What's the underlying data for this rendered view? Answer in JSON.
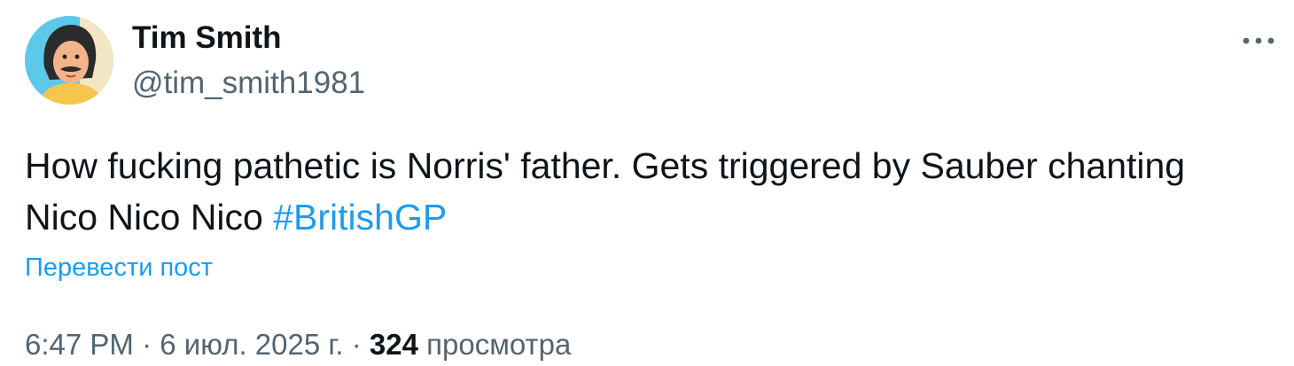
{
  "author": {
    "display_name": "Tim Smith",
    "handle": "@tim_smith1981",
    "avatar_icon": "cartoon-character-avatar"
  },
  "post": {
    "text_before": "How fucking pathetic is Norris' father. Gets triggered by Sauber chanting\nNico Nico Nico ",
    "hashtag": "#BritishGP",
    "translate_label": "Перевести пост"
  },
  "meta": {
    "time": "6:47 PM",
    "separator1": " · ",
    "date": "6 июл. 2025 г.",
    "separator2": " · ",
    "views_count": "324",
    "views_label": " просмотра"
  },
  "icons": {
    "more": "more-horizontal-icon"
  },
  "colors": {
    "link": "#1d9bf0",
    "text": "#0f1419",
    "secondary": "#536471",
    "background": "#ffffff"
  }
}
